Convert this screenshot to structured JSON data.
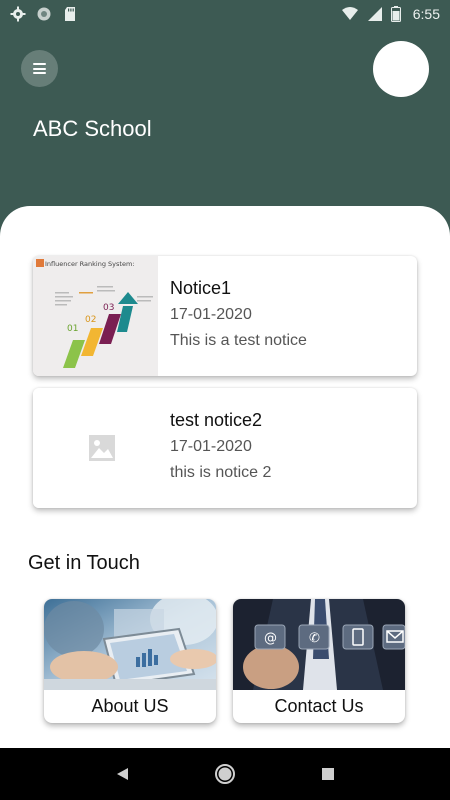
{
  "status_bar": {
    "time": "6:55",
    "left_icons": [
      "gear-icon",
      "circle-icon",
      "sd-card-icon"
    ],
    "right_icons": [
      "wifi-icon",
      "signal-icon",
      "battery-icon"
    ]
  },
  "header": {
    "school_name": "ABC School",
    "menu_icon": "hamburger-menu-icon",
    "avatar": "profile-avatar"
  },
  "notices": [
    {
      "title": "Notice1",
      "date": "17-01-2020",
      "description": "This is a test notice",
      "thumbnail": "infographic-image",
      "thumbnail_caption": "Influencer Ranking System:"
    },
    {
      "title": "test notice2",
      "date": "17-01-2020",
      "description": "this is notice 2",
      "thumbnail": "image-placeholder-icon"
    }
  ],
  "get_in_touch": {
    "title": "Get in Touch",
    "cards": [
      {
        "label": "About US",
        "image": "tablet-meeting-photo"
      },
      {
        "label": "Contact Us",
        "image": "businessman-contact-icons-photo"
      }
    ]
  },
  "nav_bar": {
    "buttons": [
      "back-icon",
      "home-icon",
      "recents-icon"
    ]
  },
  "colors": {
    "header_bg": "#3d5a53",
    "content_bg": "#ffffff",
    "nav_bg": "#000000"
  }
}
